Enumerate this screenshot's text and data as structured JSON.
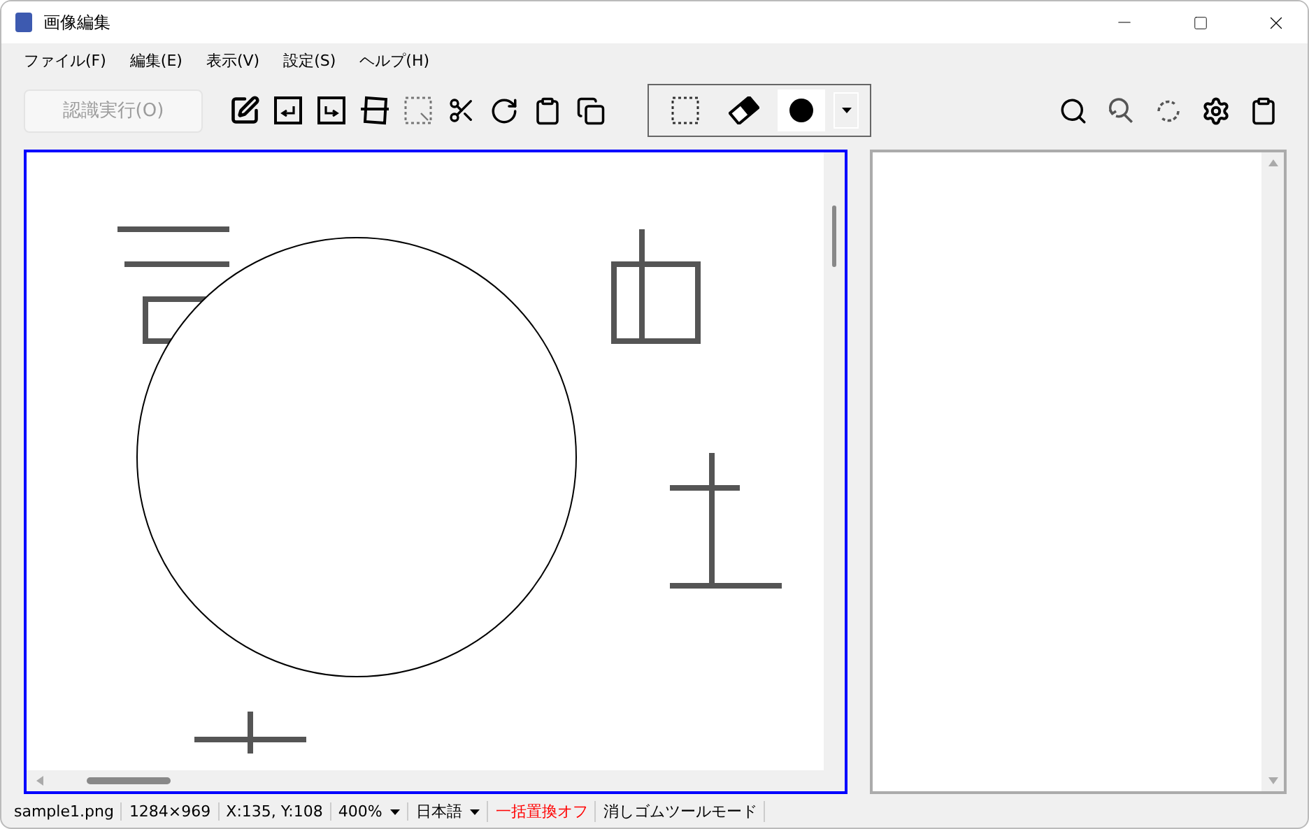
{
  "window": {
    "title": "画像編集"
  },
  "menu": [
    "ファイル(F)",
    "編集(E)",
    "表示(V)",
    "設定(S)",
    "ヘルプ(H)"
  ],
  "toolbar": {
    "recognize_button": {
      "label": "認識実行(O)",
      "disabled": true
    },
    "tools": [
      {
        "kind": "rect-select",
        "selected": false
      },
      {
        "kind": "eraser",
        "selected": false
      },
      {
        "kind": "brush-size",
        "selected": true
      }
    ]
  },
  "status_bar": [
    {
      "kind": "text",
      "text": "sample1.png"
    },
    {
      "kind": "text",
      "text": "1284×969"
    },
    {
      "kind": "text",
      "text": "X:135, Y:108"
    },
    {
      "kind": "dropdown",
      "text": "400%"
    },
    {
      "kind": "dropdown",
      "text": "日本語"
    },
    {
      "kind": "alert",
      "text": "一括置換オフ"
    },
    {
      "kind": "text",
      "text": "消しゴムツールモード"
    }
  ]
}
